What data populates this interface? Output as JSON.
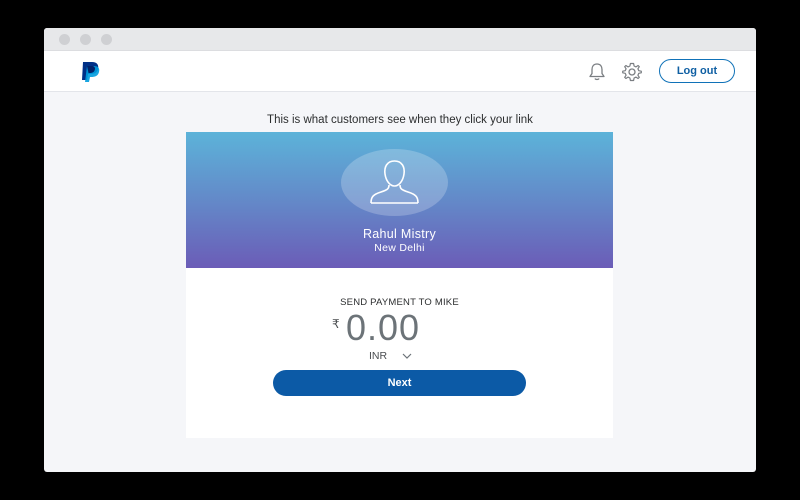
{
  "header": {
    "logout_label": "Log out",
    "brand_color": "#003087",
    "accent_color": "#0c5aa6",
    "icons": [
      "paypal-logo",
      "bell-icon",
      "gear-icon"
    ]
  },
  "preview": {
    "caption": "This is what customers see when they click your link",
    "profile": {
      "name": "Rahul Mistry",
      "location": "New Delhi",
      "avatar_icon": "user-silhouette-icon"
    },
    "payment": {
      "label": "SEND PAYMENT TO MIKE",
      "currency_symbol": "₹",
      "amount": "0.00",
      "currency": "INR",
      "next_label": "Next"
    },
    "hero_gradient": [
      "#5cb3d9",
      "#6b5cb7"
    ]
  }
}
